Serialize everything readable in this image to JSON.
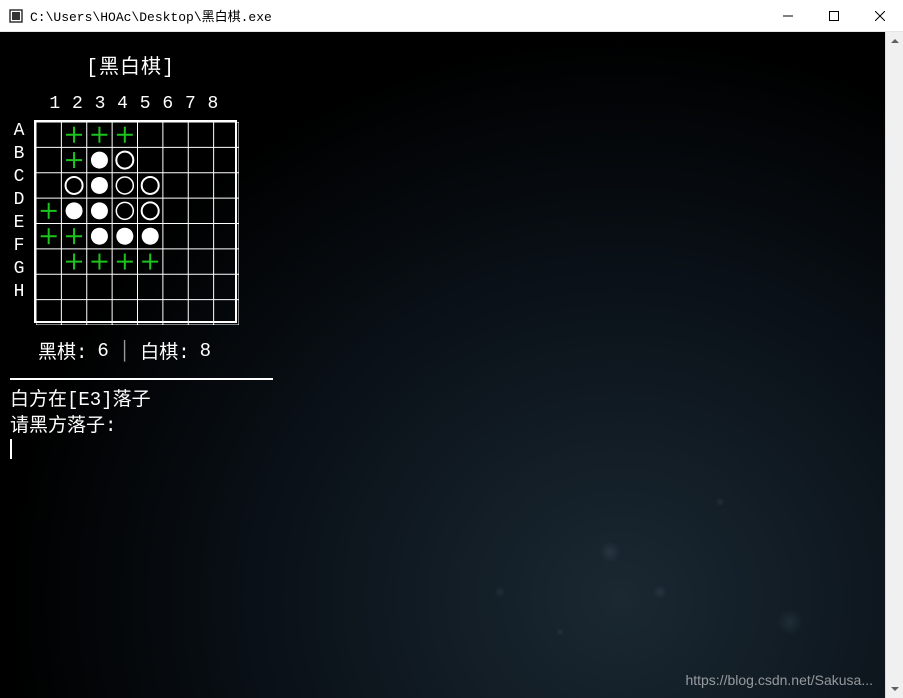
{
  "window": {
    "title": "C:\\Users\\HOAc\\Desktop\\黑白棋.exe"
  },
  "game": {
    "title": "[黑白棋]",
    "columns": [
      "1",
      "2",
      "3",
      "4",
      "5",
      "6",
      "7",
      "8"
    ],
    "rows": [
      "A",
      "B",
      "C",
      "D",
      "E",
      "F",
      "G",
      "H"
    ],
    "board_size": 8,
    "pieces": [
      {
        "pos": "B3",
        "color": "white",
        "type": "filled"
      },
      {
        "pos": "B4",
        "color": "white",
        "type": "hollow"
      },
      {
        "pos": "C2",
        "color": "white",
        "type": "hollow"
      },
      {
        "pos": "C3",
        "color": "white",
        "type": "filled"
      },
      {
        "pos": "C4",
        "color": "black",
        "type": "filled"
      },
      {
        "pos": "C5",
        "color": "white",
        "type": "hollow"
      },
      {
        "pos": "D2",
        "color": "white",
        "type": "filled"
      },
      {
        "pos": "D3",
        "color": "white",
        "type": "filled"
      },
      {
        "pos": "D4",
        "color": "black",
        "type": "filled"
      },
      {
        "pos": "D5",
        "color": "white",
        "type": "hollow"
      },
      {
        "pos": "E3",
        "color": "white",
        "type": "filled"
      },
      {
        "pos": "E4",
        "color": "white",
        "type": "filled"
      },
      {
        "pos": "E5",
        "color": "white",
        "type": "filled"
      }
    ],
    "hints": [
      {
        "pos": "A2"
      },
      {
        "pos": "A3"
      },
      {
        "pos": "A4"
      },
      {
        "pos": "B2"
      },
      {
        "pos": "D1"
      },
      {
        "pos": "E1"
      },
      {
        "pos": "E2"
      },
      {
        "pos": "F2"
      },
      {
        "pos": "F3"
      },
      {
        "pos": "F4"
      },
      {
        "pos": "F5"
      }
    ],
    "score": {
      "black_label": "黑棋:",
      "black_value": "6",
      "white_label": "白棋:",
      "white_value": "8"
    },
    "log": [
      "白方在[E3]落子",
      "请黑方落子:"
    ]
  },
  "watermark": "https://blog.csdn.net/Sakusa..."
}
